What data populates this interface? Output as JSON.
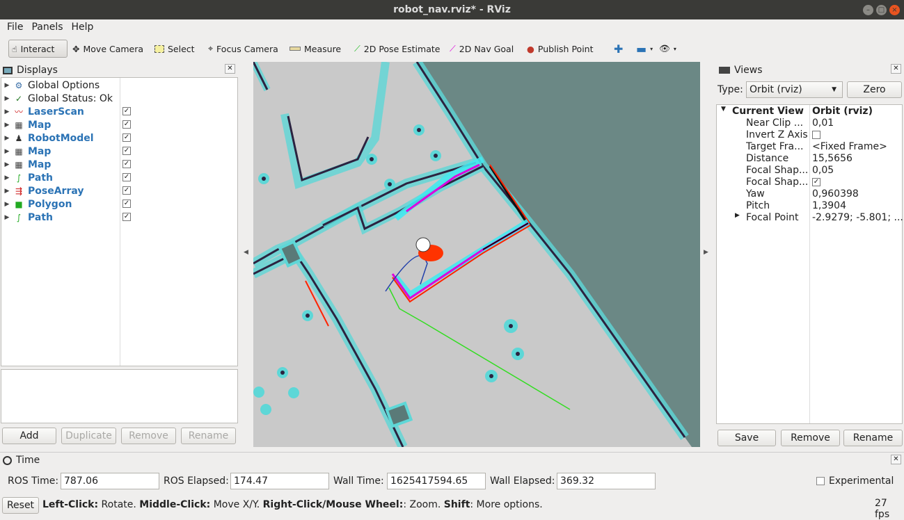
{
  "window": {
    "title": "robot_nav.rviz* - RViz"
  },
  "menu": [
    "File",
    "Panels",
    "Help"
  ],
  "toolbar": {
    "interact": "Interact",
    "move_camera": "Move Camera",
    "select": "Select",
    "focus_camera": "Focus Camera",
    "measure": "Measure",
    "pose_estimate": "2D Pose Estimate",
    "nav_goal": "2D Nav Goal",
    "publish_point": "Publish Point"
  },
  "displays": {
    "title": "Displays",
    "items": [
      {
        "label": "Global Options",
        "icon": "gear-icon",
        "checked": null
      },
      {
        "label": "Global Status: Ok",
        "icon": "checkmark-icon",
        "checked": null
      },
      {
        "label": "LaserScan",
        "icon": "laserscan-icon",
        "checked": true
      },
      {
        "label": "Map",
        "icon": "map-icon",
        "checked": true
      },
      {
        "label": "RobotModel",
        "icon": "robot-icon",
        "checked": true
      },
      {
        "label": "Map",
        "icon": "map-icon",
        "checked": true
      },
      {
        "label": "Map",
        "icon": "map-icon",
        "checked": true
      },
      {
        "label": "Path",
        "icon": "path-icon",
        "checked": true
      },
      {
        "label": "PoseArray",
        "icon": "posearray-icon",
        "checked": true
      },
      {
        "label": "Polygon",
        "icon": "polygon-icon",
        "checked": true
      },
      {
        "label": "Path",
        "icon": "path-icon",
        "checked": true
      }
    ],
    "buttons": {
      "add": "Add",
      "duplicate": "Duplicate",
      "remove": "Remove",
      "rename": "Rename"
    }
  },
  "views": {
    "title": "Views",
    "type_label": "Type:",
    "type_value": "Orbit (rviz)",
    "zero": "Zero",
    "current_view": {
      "key": "Current View",
      "value": "Orbit (rviz)"
    },
    "properties": [
      {
        "key": "Near Clip ...",
        "value": "0,01"
      },
      {
        "key": "Invert Z Axis",
        "value": ""
      },
      {
        "key": "Target Fra...",
        "value": "<Fixed Frame>"
      },
      {
        "key": "Distance",
        "value": "15,5656"
      },
      {
        "key": "Focal Shap...",
        "value": "0,05"
      },
      {
        "key": "Focal Shap...",
        "value": ""
      },
      {
        "key": "Yaw",
        "value": "0,960398"
      },
      {
        "key": "Pitch",
        "value": "1,3904"
      },
      {
        "key": "Focal Point",
        "value": "-2.9279; -5.801; ..."
      }
    ],
    "invert_z_checked": false,
    "focal_shape_fixed_checked": true,
    "buttons": {
      "save": "Save",
      "remove": "Remove",
      "rename": "Rename"
    }
  },
  "time": {
    "title": "Time",
    "ros_time_label": "ROS Time:",
    "ros_time": "787.06",
    "ros_elapsed_label": "ROS Elapsed:",
    "ros_elapsed": "174.47",
    "wall_time_label": "Wall Time:",
    "wall_time": "1625417594.65",
    "wall_elapsed_label": "Wall Elapsed:",
    "wall_elapsed": "369.32",
    "experimental": "Experimental"
  },
  "status": {
    "reset": "Reset",
    "help_parts": [
      {
        "bold": true,
        "text": "Left-Click:"
      },
      {
        "bold": false,
        "text": " Rotate. "
      },
      {
        "bold": true,
        "text": "Middle-Click:"
      },
      {
        "bold": false,
        "text": " Move X/Y. "
      },
      {
        "bold": true,
        "text": "Right-Click/Mouse Wheel:"
      },
      {
        "bold": false,
        "text": ": Zoom. "
      },
      {
        "bold": true,
        "text": "Shift"
      },
      {
        "bold": false,
        "text": ": More options."
      }
    ],
    "fps": "27 fps"
  },
  "colors": {
    "laser": "#ff2a00",
    "path_green": "#22cc22",
    "path_magenta": "#dd00dd",
    "costmap_cyan": "#55dddd",
    "unknown": "#6a8a86",
    "free": "#c8c8c8"
  }
}
